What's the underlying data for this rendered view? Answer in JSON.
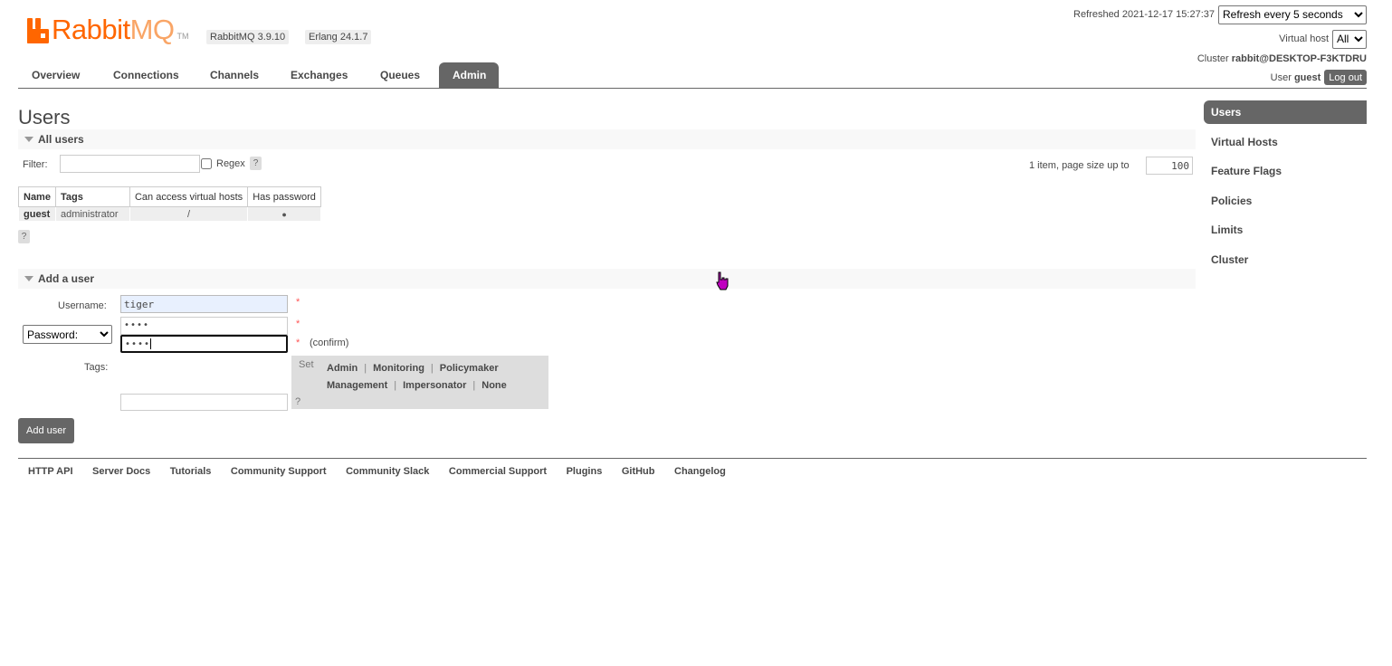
{
  "header": {
    "logo_main": "Rabbit",
    "logo_mq": "MQ",
    "logo_tm": "TM",
    "rabbitmq_version": "RabbitMQ 3.9.10",
    "erlang_version": "Erlang 24.1.7",
    "refreshed_label": "Refreshed 2021-12-17 15:27:37",
    "refresh_select": "Refresh every 5 seconds",
    "vhost_label": "Virtual host",
    "vhost_select": "All",
    "cluster_label": "Cluster",
    "cluster_name": "rabbit@DESKTOP-F3KTDRU",
    "user_label": "User",
    "user_name": "guest",
    "logout": "Log out"
  },
  "tabs": [
    "Overview",
    "Connections",
    "Channels",
    "Exchanges",
    "Queues",
    "Admin"
  ],
  "active_tab": "Admin",
  "rightnav": [
    "Users",
    "Virtual Hosts",
    "Feature Flags",
    "Policies",
    "Limits",
    "Cluster"
  ],
  "page_title": "Users",
  "all_users": {
    "heading": "All users",
    "filter_label": "Filter:",
    "filter_value": "",
    "regex_label": "Regex",
    "help": "?",
    "pagination_text": "1 item, page size up to",
    "page_size": "100",
    "columns": [
      "Name",
      "Tags",
      "Can access virtual hosts",
      "Has password"
    ],
    "rows": [
      {
        "name": "guest",
        "tags": "administrator",
        "vhosts": "/",
        "has_password": "●"
      }
    ]
  },
  "add_user": {
    "heading": "Add a user",
    "username_label": "Username:",
    "username_value": "tiger",
    "password_mode": "Password:",
    "password_value": "••••",
    "confirm_value": "••••",
    "required": "*",
    "confirm_label": "(confirm)",
    "tags_label": "Tags:",
    "tags_value": "",
    "set_label": "Set",
    "tag_options": [
      "Admin",
      "Monitoring",
      "Policymaker",
      "Management",
      "Impersonator",
      "None"
    ],
    "separator": "|",
    "submit": "Add user"
  },
  "footer": [
    "HTTP API",
    "Server Docs",
    "Tutorials",
    "Community Support",
    "Community Slack",
    "Commercial Support",
    "Plugins",
    "GitHub",
    "Changelog"
  ],
  "colors": {
    "brand_orange": "#ff6600",
    "tab_active": "#666666",
    "cursor": "#c000c0"
  }
}
